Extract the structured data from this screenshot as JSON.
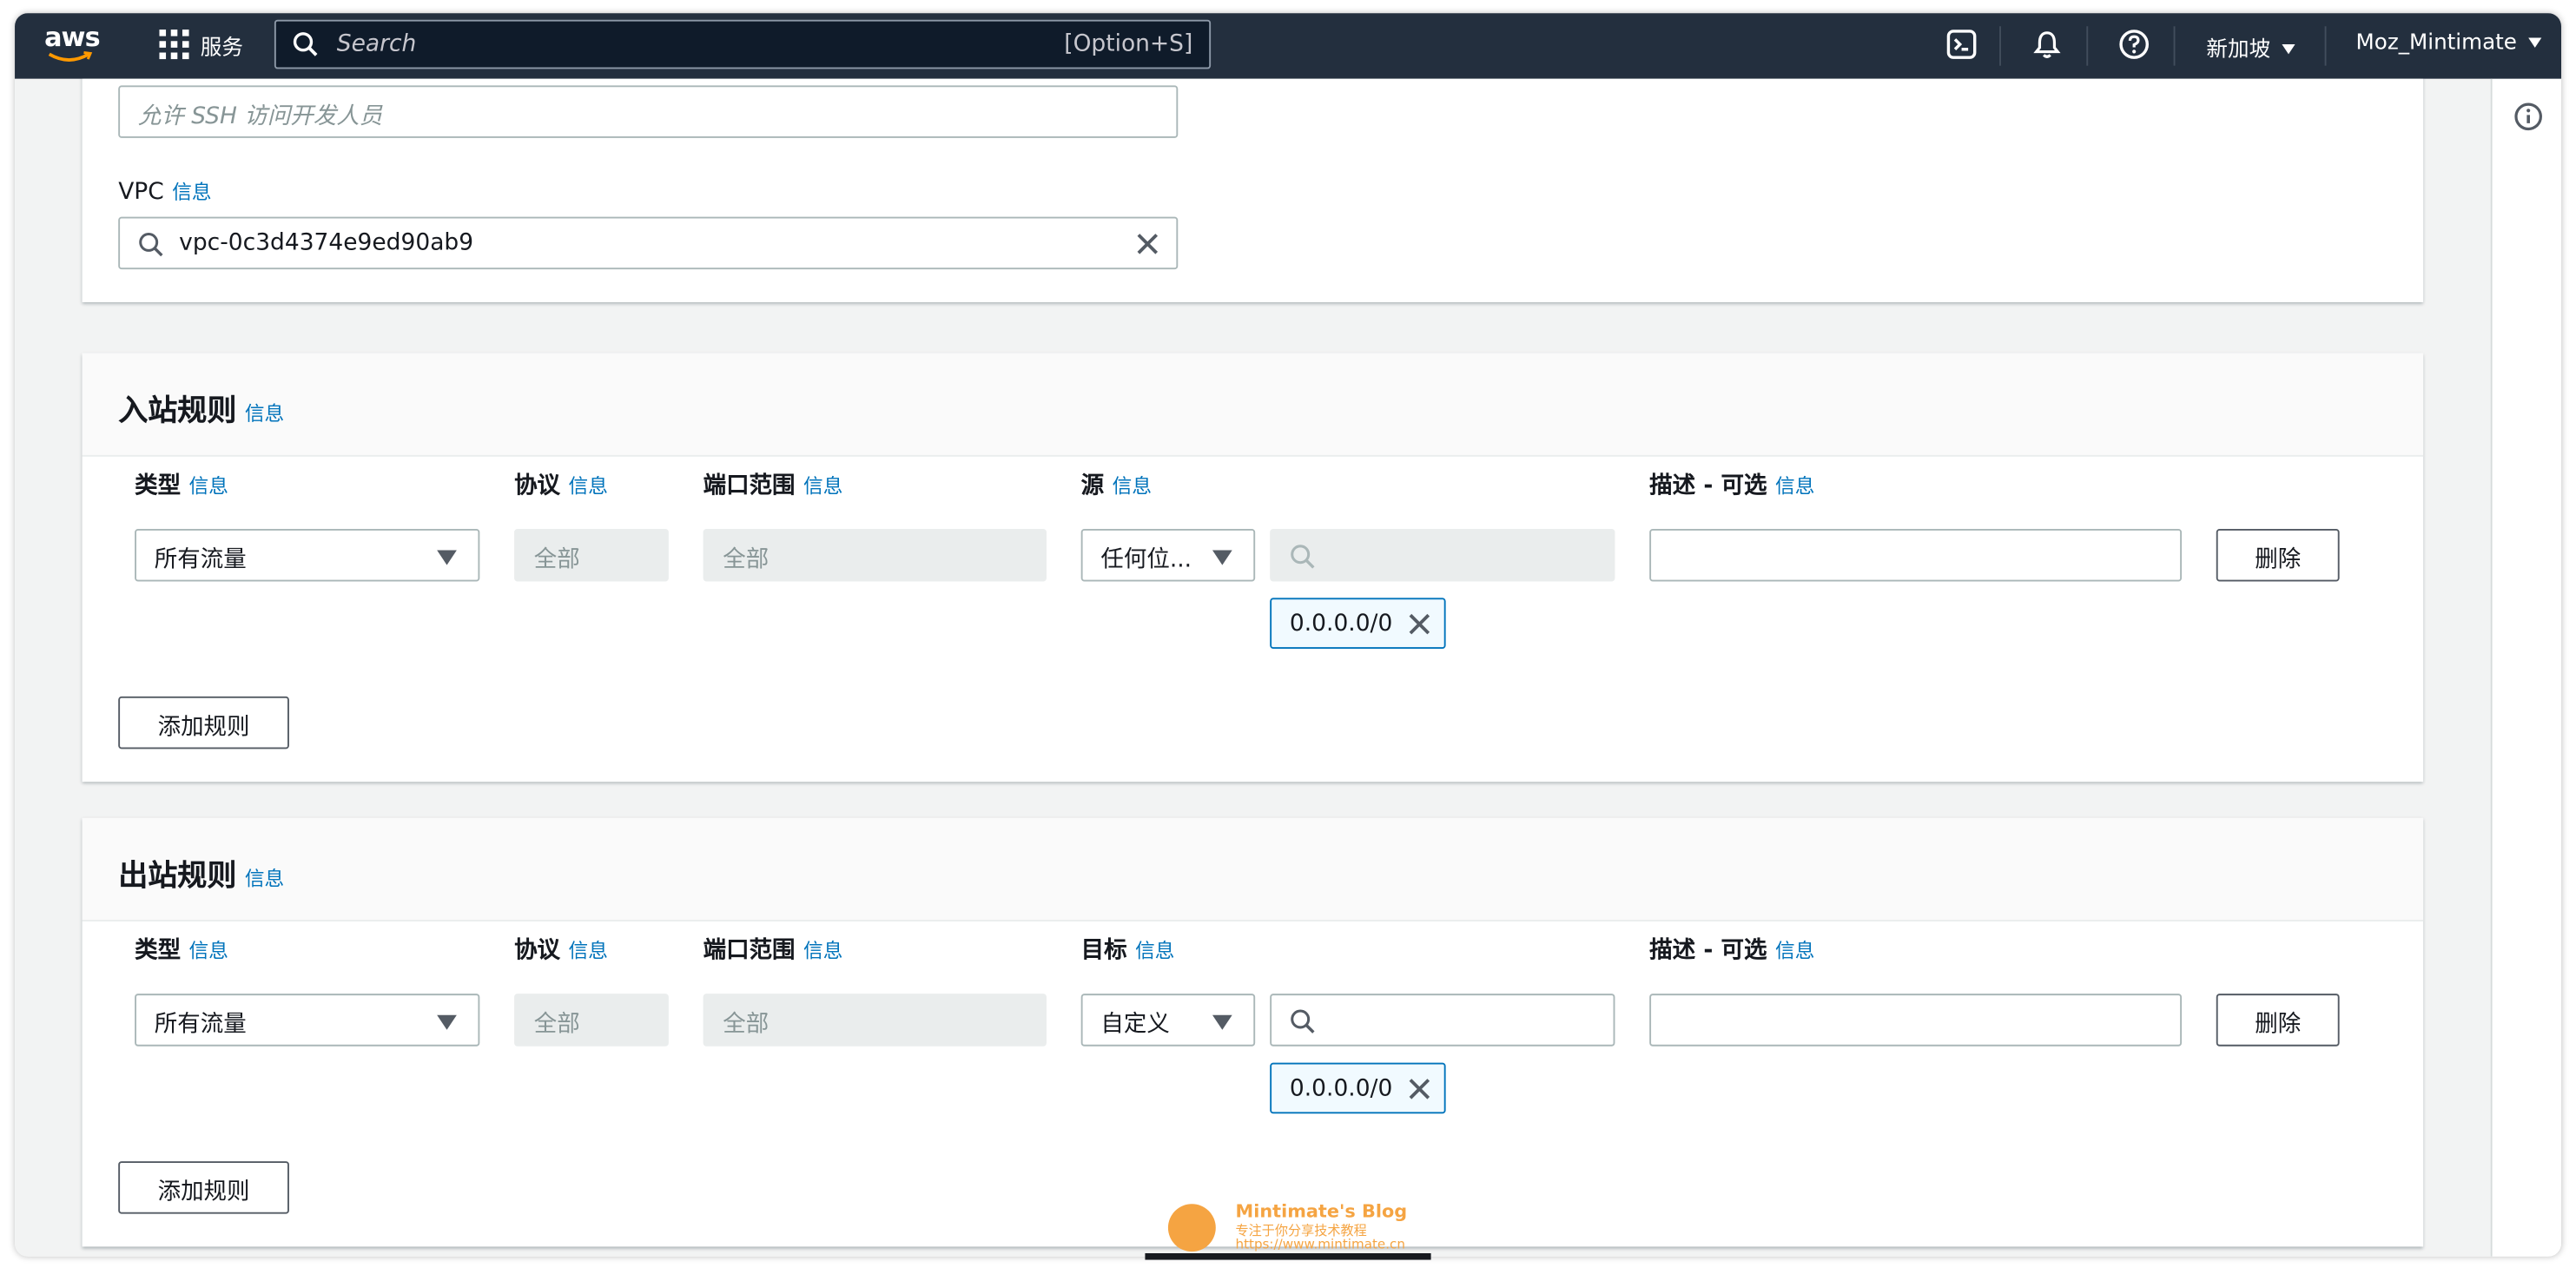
{
  "topbar": {
    "logo_text": "aws",
    "services_label": "服务",
    "search_placeholder": "Search",
    "search_shortcut": "[Option+S]",
    "region": "新加坡",
    "user": "Moz_Mintimate"
  },
  "form": {
    "desc_placeholder": "允许 SSH 访问开发人员",
    "vpc_label": "VPC",
    "info_link": "信息",
    "vpc_value": "vpc-0c3d4374e9ed90ab9"
  },
  "inbound": {
    "title": "入站规则",
    "info": "信息",
    "headers": {
      "type": "类型",
      "protocol": "协议",
      "port_range": "端口范围",
      "source": "源",
      "description": "描述 - 可选"
    },
    "row": {
      "type": "所有流量",
      "protocol": "全部",
      "port_range": "全部",
      "source_type": "任何位...",
      "source_token": "0.0.0.0/0",
      "delete_label": "删除"
    },
    "add_rule_label": "添加规则"
  },
  "outbound": {
    "title": "出站规则",
    "info": "信息",
    "headers": {
      "type": "类型",
      "protocol": "协议",
      "port_range": "端口范围",
      "destination": "目标",
      "description": "描述 - 可选"
    },
    "row": {
      "type": "所有流量",
      "protocol": "全部",
      "port_range": "全部",
      "dest_type": "自定义",
      "dest_token": "0.0.0.0/0",
      "delete_label": "删除"
    },
    "add_rule_label": "添加规则"
  },
  "watermark": {
    "title": "Mintimate's Blog",
    "subtitle": "专注于你分享技术教程",
    "url": "https://www.mintimate.cn"
  },
  "colors": {
    "nav_bg": "#232f3e",
    "link": "#0073bb",
    "token_border": "#0073bb",
    "page_bg": "#f2f3f3"
  }
}
